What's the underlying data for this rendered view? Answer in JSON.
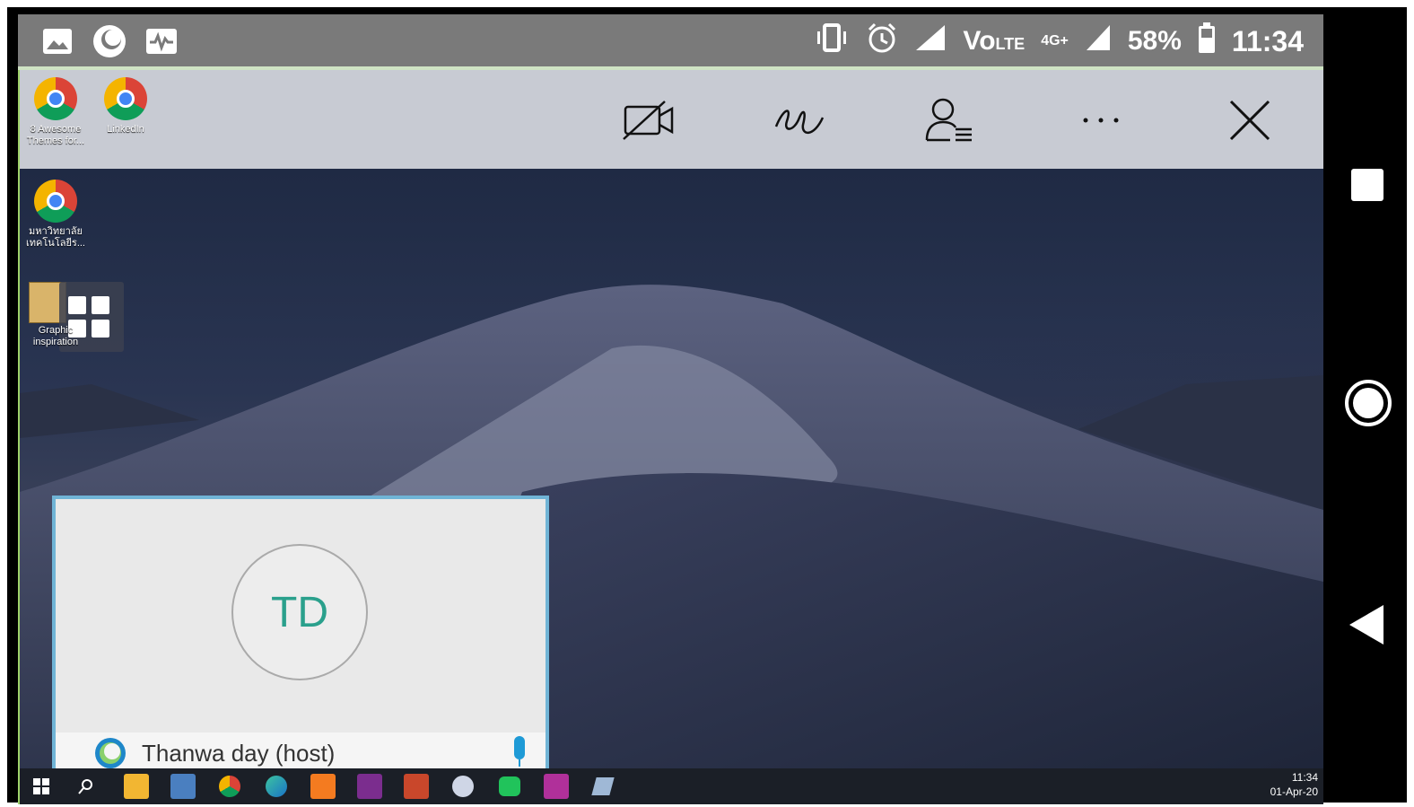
{
  "status_bar": {
    "battery": "58%",
    "time": "11:34",
    "network": "4G+",
    "left_icons": [
      "gallery-icon",
      "sync-icon",
      "activity-icon"
    ]
  },
  "toolbar": {
    "buttons": [
      "video-off-icon",
      "annotate-icon",
      "participants-icon",
      "more-icon",
      "close-icon"
    ]
  },
  "desktop_icons": [
    {
      "label": "8 Awesome Themes for..."
    },
    {
      "label": "LinkedIn"
    },
    {
      "label": "มหาวิทยาลัยเทคโนโลยีร..."
    },
    {
      "label": "Graphic inspiration"
    }
  ],
  "video_tile": {
    "initials": "TD",
    "name": "Thanwa day (host)"
  },
  "taskbar": {
    "time": "11:34",
    "date": "01-Apr-20"
  },
  "colors": {
    "accent_teal": "#2aa08c",
    "tile_border": "#70b4d6",
    "frame_green": "#9fd36a"
  }
}
